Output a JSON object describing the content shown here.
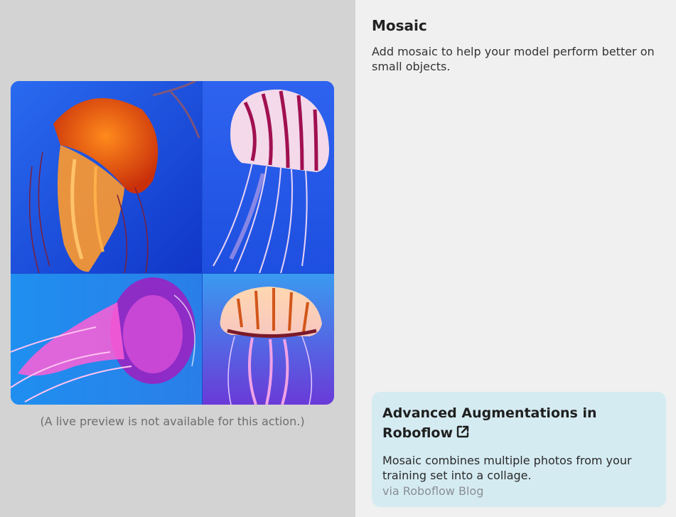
{
  "preview": {
    "caption": "(A live preview is not available for this action.)"
  },
  "augmentation": {
    "title": "Mosaic",
    "description": "Add mosaic to help your model perform better on small objects."
  },
  "card": {
    "title": "Advanced Augmentations in Roboflow",
    "body": "Mosaic combines multiple photos from your training set into a collage.",
    "source": "via Roboflow Blog",
    "link_icon": "external-link-icon"
  },
  "colors": {
    "left_pane_bg": "#d3d3d3",
    "right_pane_bg": "#f0f0f0",
    "card_bg": "#d5ebf2"
  }
}
